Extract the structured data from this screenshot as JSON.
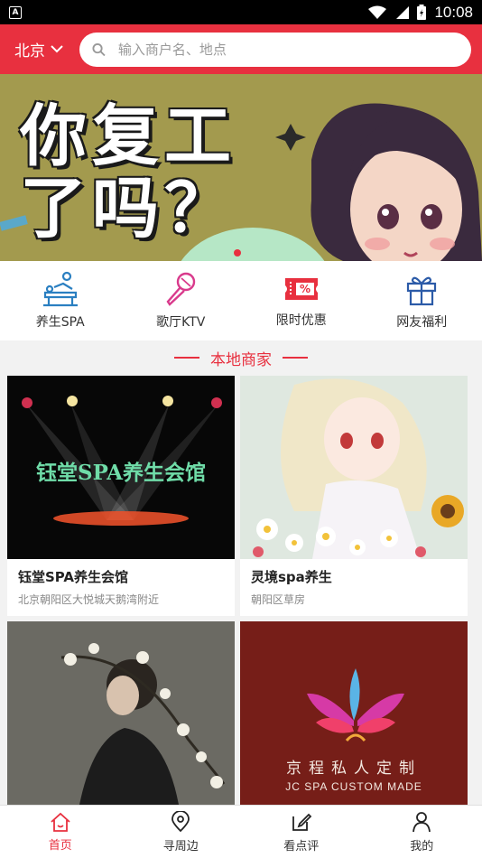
{
  "status_bar": {
    "time": "10:08",
    "app_badge": "A"
  },
  "header": {
    "city": "北京",
    "search_placeholder": "输入商户名、地点"
  },
  "banner": {
    "line1": "你复工",
    "line2": "了吗？",
    "accent_color": "#e8303f"
  },
  "categories": [
    {
      "label": "养生SPA",
      "icon": "massage-table-icon",
      "color": "#2a7fc1"
    },
    {
      "label": "歌厅KTV",
      "icon": "microphone-icon",
      "color": "#d93a8c"
    },
    {
      "label": "限时优惠",
      "icon": "discount-ticket-icon",
      "color": "#e8303f"
    },
    {
      "label": "网友福利",
      "icon": "gift-icon",
      "color": "#2c5ba8"
    }
  ],
  "section": {
    "title": "本地商家"
  },
  "merchants": [
    {
      "name": "钰堂SPA养生会馆",
      "address": "北京朝阳区大悦城天鹅湾附近",
      "image_text": "钰堂SPA养生会馆"
    },
    {
      "name": "灵境spa养生",
      "address": "朝阳区草房"
    },
    {
      "name": "",
      "address": ""
    },
    {
      "name": "",
      "address": "",
      "image_text_cn": "京程私人定制",
      "image_text_en": "JC SPA CUSTOM MADE"
    }
  ],
  "tabbar": [
    {
      "label": "首页",
      "icon": "home-icon",
      "active": true
    },
    {
      "label": "寻周边",
      "icon": "location-pin-icon",
      "active": false
    },
    {
      "label": "看点评",
      "icon": "edit-review-icon",
      "active": false
    },
    {
      "label": "我的",
      "icon": "user-icon",
      "active": false
    }
  ],
  "colors": {
    "primary": "#e8303f",
    "background": "#f2f2f2"
  }
}
